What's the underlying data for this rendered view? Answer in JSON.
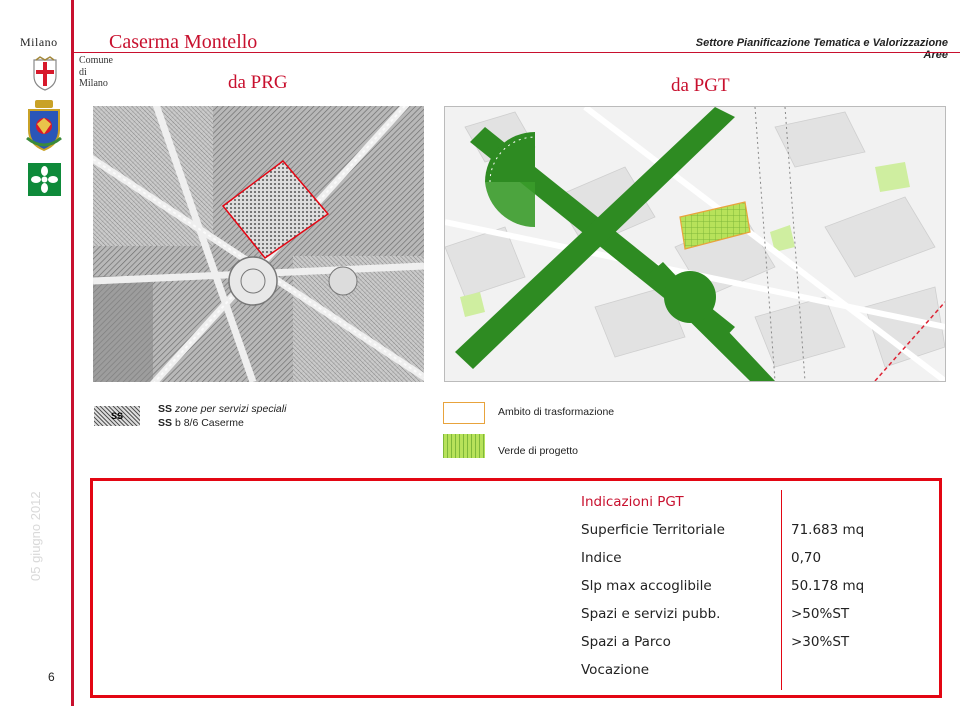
{
  "sidebar": {
    "milano_wordmark": "Milano",
    "comune_line1": "Comune",
    "comune_line2": "di Milano",
    "date": "05 giugno 2012",
    "page_number": "6"
  },
  "header": {
    "title": "Caserma Montello",
    "settore": "Settore Pianificazione Tematica e Valorizzazione Aree",
    "left_subtitle": "da PRG",
    "right_subtitle": "da PGT"
  },
  "legend": {
    "ss_symbol": "SS",
    "ss_line1_code": "SS",
    "ss_line1_text": "zone per servizi speciali",
    "ss_line2_code": "SS",
    "ss_line2_text": "b 8/6 Caserme",
    "ambito": "Ambito di trasformazione",
    "verde": "Verde di progetto"
  },
  "pgt": {
    "heading": "Indicazioni PGT",
    "rows": [
      {
        "label": "Superficie Territoriale",
        "value": "71.683 mq"
      },
      {
        "label": "Indice",
        "value": "0,70"
      },
      {
        "label": "Slp max accoglibile",
        "value": "50.178 mq"
      },
      {
        "label": "Spazi e servizi pubb.",
        "value": ">50%ST"
      },
      {
        "label": "Spazi a Parco",
        "value": ">30%ST"
      },
      {
        "label": "Vocazione",
        "value": ""
      }
    ]
  },
  "colors": {
    "accent_red": "#c8102e",
    "box_red": "#e30613",
    "green_corridor": "#2e8b22",
    "verde_progetto": "#a8d84a",
    "ambito_orange": "#e8a33c"
  }
}
